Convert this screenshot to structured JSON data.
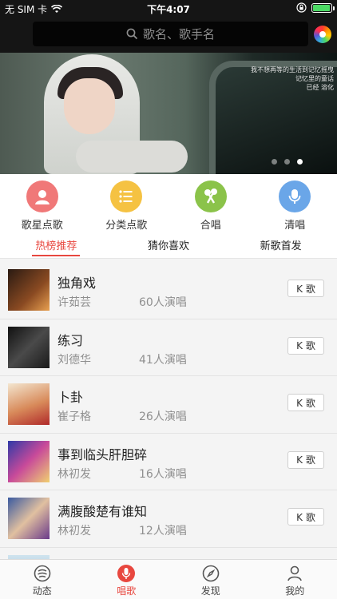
{
  "status_bar": {
    "carrier": "无 SIM 卡",
    "time": "下午4:07",
    "battery_level": 0.95,
    "wifi_icon": "wifi-icon",
    "lock_icon": "orientation-lock-icon"
  },
  "header": {
    "search_placeholder": "歌名、歌手名",
    "search_icon": "search-icon",
    "theme_icon": "color-wheel-icon"
  },
  "banner": {
    "caption_line1": "我不想再等的生活到记忆摇曳",
    "caption_line2": "记忆里的童话",
    "caption_line3": "已经        溶化",
    "slide_count": 3,
    "active_slide": 3
  },
  "categories": [
    {
      "label": "歌星点歌",
      "icon": "singer-icon",
      "color": "#f07878"
    },
    {
      "label": "分类点歌",
      "icon": "list-icon",
      "color": "#f5c242"
    },
    {
      "label": "合唱",
      "icon": "duet-mic-icon",
      "color": "#8bc34a"
    },
    {
      "label": "清唱",
      "icon": "microphone-icon",
      "color": "#6aa6e8"
    }
  ],
  "tabs": [
    {
      "label": "热榜推荐",
      "active": true
    },
    {
      "label": "猜你喜欢",
      "active": false
    },
    {
      "label": "新歌首发",
      "active": false
    }
  ],
  "songs": [
    {
      "title": "独角戏",
      "singer": "许茹芸",
      "count": "60人演唱",
      "button": "K 歌"
    },
    {
      "title": "练习",
      "singer": "刘德华",
      "count": "41人演唱",
      "button": "K 歌"
    },
    {
      "title": "卜卦",
      "singer": "崔子格",
      "count": "26人演唱",
      "button": "K 歌"
    },
    {
      "title": "事到临头肝胆碎",
      "singer": "林初发",
      "count": "16人演唱",
      "button": "K 歌"
    },
    {
      "title": "满腹酸楚有谁知",
      "singer": "林初发",
      "count": "12人演唱",
      "button": "K 歌"
    }
  ],
  "tabbar": [
    {
      "label": "动态",
      "icon": "feed-icon",
      "active": false
    },
    {
      "label": "唱歌",
      "icon": "microphone-icon",
      "active": true
    },
    {
      "label": "发现",
      "icon": "compass-icon",
      "active": false
    },
    {
      "label": "我的",
      "icon": "person-icon",
      "active": false
    }
  ],
  "colors": {
    "accent": "#e8473f",
    "header_bg": "#151515"
  }
}
